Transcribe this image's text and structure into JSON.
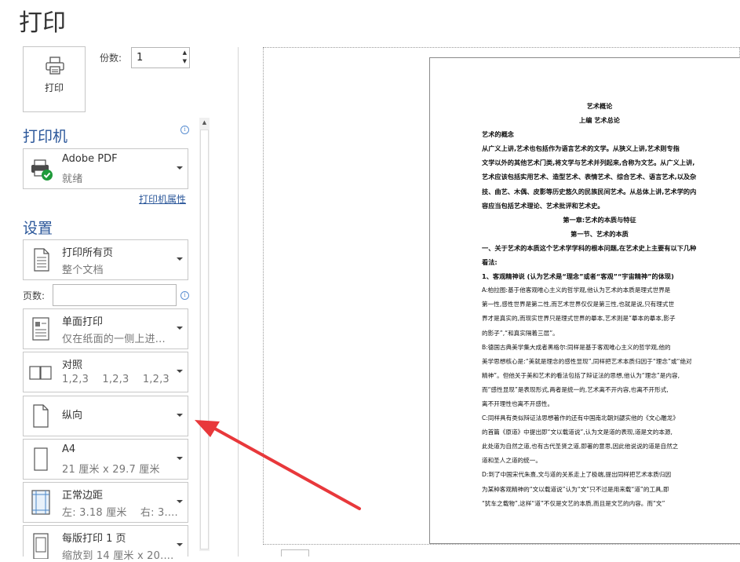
{
  "title": "打印",
  "print_button": {
    "label": "打印",
    "icon": "printer-icon"
  },
  "copies": {
    "label": "份数:",
    "value": "1"
  },
  "printer_section": {
    "heading": "打印机",
    "printer_name": "Adobe PDF",
    "printer_status": "就绪",
    "properties_link": "打印机属性"
  },
  "settings_section": {
    "heading": "设置",
    "print_range": {
      "line1": "打印所有页",
      "line2": "整个文档"
    },
    "pages": {
      "label": "页数:",
      "value": ""
    },
    "sides": {
      "line1": "单面打印",
      "line2": "仅在纸面的一侧上进..."
    },
    "collate": {
      "line1": "对照",
      "line2": "1,2,3    1,2,3    1,2,3"
    },
    "orientation": {
      "line1": "纵向"
    },
    "paper": {
      "line1": "A4",
      "line2": "21 厘米 x 29.7 厘米"
    },
    "margins": {
      "line1": "正常边距",
      "line2": "左: 3.18 厘米    右: 3...."
    },
    "pages_per_sheet": {
      "line1": "每版打印 1 页",
      "line2": "缩放到 14 厘米 x 20...."
    }
  },
  "colors": {
    "accent": "#2b579a",
    "arrow": "#e8383b"
  },
  "document_preview": {
    "lines": [
      "艺术概论",
      "上编  艺术总论",
      "艺术的概念",
      "    从广义上讲,艺术也包括作为语言艺术的文学。从狭义上讲,艺术则专指",
      "文学以外的其他艺术门类,将文学与艺术并列起来,合称为文艺。从广义上讲,",
      "艺术应该包括实用艺术、造型艺术、表情艺术、综合艺术、语言艺术,以及杂",
      "技、曲艺、木偶、皮影等历史悠久的民族民间艺术。从总体上讲,艺术学的内",
      "容应当包括艺术理论、艺术批评和艺术史。",
      "第一章:艺术的本质与特征",
      "第一节、艺术的本质",
      "一、关于艺术的本质这个艺术学学科的根本问题,在艺术史上主要有以下几种",
      "看法:",
      "1、客观精神说  (认为艺术是“理念”或者“客观”“宇宙精神”的体现)",
      "    A:柏拉图:基于他客观唯心主义的哲学观,他认为艺术的本质是理式世界是",
      "第一性,感性世界是第二性,而艺术世界仅仅是第三性,也就是说,只有理式世",
      "界才是真实的,而现实世界只是理式世界的摹本,艺术则是“摹本的摹本,影子",
      "的影子”,“和真实隔着三层”。",
      "    B:德国古典美学集大成者黑格尔:同样是基于客观唯心主义的哲学观,他的",
      "美学思想核心是:“美就是理念的感性显现”,同样把艺术本质归因于“理念”或“绝对",
      "精神”。但他关于美和艺术的看法包括了辩证法的思想,他认为“理念”是内容,",
      "而“感性显现”是表现形式,两者是统一的,艺术离不开内容,也离不开形式,",
      "离不开理性也离不开感性。",
      "    C:同样具有类似辩证法思想著作的还有中国南北朝刘勰实他的《文心雕龙》",
      "的首篇《原道》中提出即“文以载道说”,认为文是道的表现,道是文的本源,",
      "此处道为自然之道,也有古代圣贤之道,即著的意思,因此他说说的道是自然之",
      "道和圣人之道的统一。",
      "    D:到了中国宋代朱熹,文与道的关系走上了极端,提出同样把艺术本质归因",
      "为某种客观精神的“文以载道说”认为“文”只不过是用来载“道”的工具,即",
      "“犹车之载物”,这样“道”不仅是文艺的本质,而且是文艺的内容。而“文”"
    ]
  }
}
